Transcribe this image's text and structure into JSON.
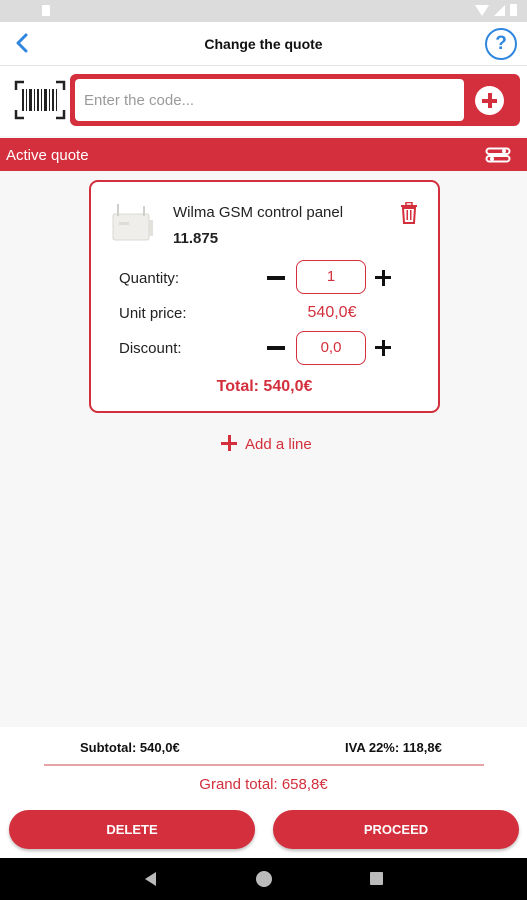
{
  "header": {
    "title": "Change the quote",
    "help_glyph": "?"
  },
  "code_input": {
    "placeholder": "Enter the code...",
    "value": ""
  },
  "active_quote": {
    "label": "Active quote"
  },
  "quote_line": {
    "product_name": "Wilma GSM control panel",
    "product_code": "11.875",
    "quantity_label": "Quantity:",
    "quantity_value": "1",
    "unit_price_label": "Unit price:",
    "unit_price_value": "540,0€",
    "discount_label": "Discount:",
    "discount_value": "0,0",
    "total": "Total: 540,0€"
  },
  "add_line": {
    "label": "Add a line"
  },
  "summary": {
    "subtotal": "Subtotal: 540,0€",
    "iva": "IVA 22%: 118,8€",
    "grand_total": "Grand total: 658,8€"
  },
  "actions": {
    "delete_label": "DELETE",
    "proceed_label": "PROCEED"
  },
  "colors": {
    "accent": "#d32f3c",
    "help_blue": "#2e86de"
  },
  "icons": [
    "back-arrow-icon",
    "help-icon",
    "barcode-icon",
    "add-circle-icon",
    "toggle-icon",
    "product-image",
    "trash-icon",
    "minus-icon",
    "plus-icon"
  ]
}
